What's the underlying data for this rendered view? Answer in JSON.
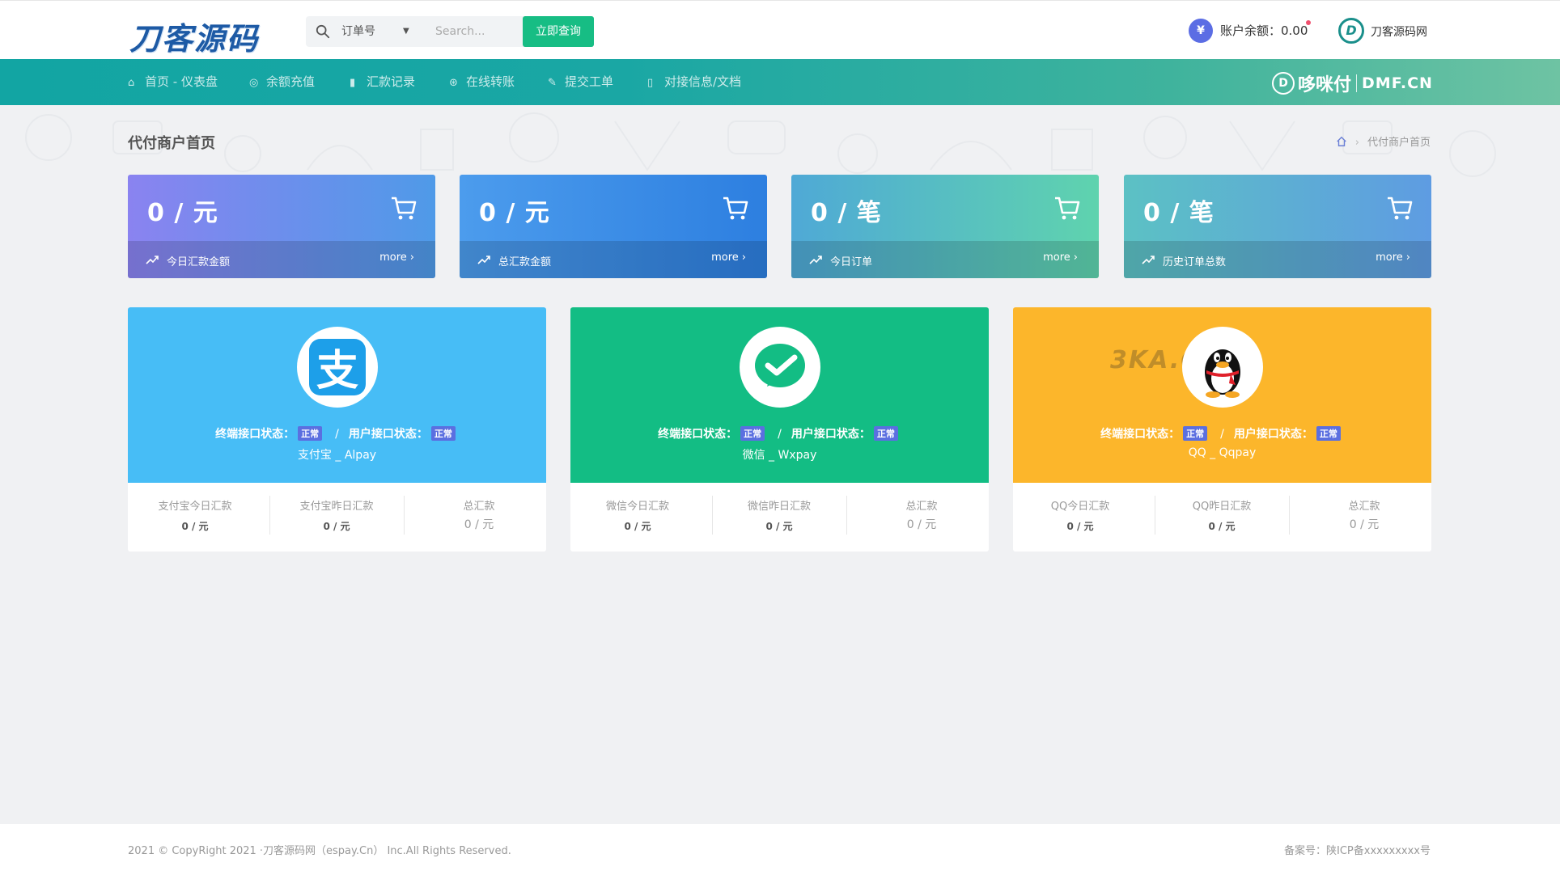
{
  "header": {
    "logo_text": "刀客源码",
    "search": {
      "select_value": "订单号",
      "placeholder": "Search...",
      "button": "立即查询"
    },
    "balance": {
      "icon": "¥",
      "label": "账户余额：0.00"
    },
    "user": {
      "name": "刀客源码网"
    }
  },
  "nav": {
    "items": [
      {
        "icon": "home-icon",
        "label": "首页 - 仪表盘"
      },
      {
        "icon": "recharge-icon",
        "label": "余额充值"
      },
      {
        "icon": "bar-chart-icon",
        "label": "汇款记录"
      },
      {
        "icon": "transfer-icon",
        "label": "在线转账"
      },
      {
        "icon": "edit-icon",
        "label": "提交工单"
      },
      {
        "icon": "doc-icon",
        "label": "对接信息/文档"
      }
    ],
    "brand": {
      "name": "哆咪付",
      "domain": "DMF.CN"
    }
  },
  "page": {
    "title": "代付商户首页",
    "breadcrumb": "代付商户首页"
  },
  "stats": [
    {
      "value": "0 / 元",
      "label": "今日汇款金额",
      "more": "more",
      "color_from": "#8a83f0",
      "color_to": "#4f9ae8"
    },
    {
      "value": "0 / 元",
      "label": "总汇款金额",
      "more": "more",
      "color_from": "#4c9ced",
      "color_to": "#2d7fe0"
    },
    {
      "value": "0 / 笔",
      "label": "今日订单",
      "more": "more",
      "color_from": "#4fa9d6",
      "color_to": "#5fd3ae"
    },
    {
      "value": "0 / 笔",
      "label": "历史订单总数",
      "more": "more",
      "color_from": "#5cc1c4",
      "color_to": "#5e9ce2"
    }
  ],
  "payments": [
    {
      "color": "#47bdf6",
      "terminal_label": "终端接口状态：",
      "terminal_status": "正常",
      "user_label": "用户接口状态：",
      "user_status": "正常",
      "slash": "/",
      "name": "支付宝 _ Alpay",
      "cols": [
        {
          "label": "支付宝今日汇款",
          "value": "0 / 元"
        },
        {
          "label": "支付宝昨日汇款",
          "value": "0 / 元"
        },
        {
          "label": "总汇款",
          "value": "0 / 元"
        }
      ]
    },
    {
      "color": "#13bd84",
      "terminal_label": "终端接口状态：",
      "terminal_status": "正常",
      "user_label": "用户接口状态：",
      "user_status": "正常",
      "slash": "/",
      "name": "微信 _ Wxpay",
      "cols": [
        {
          "label": "微信今日汇款",
          "value": "0 / 元"
        },
        {
          "label": "微信昨日汇款",
          "value": "0 / 元"
        },
        {
          "label": "总汇款",
          "value": "0 / 元"
        }
      ]
    },
    {
      "color": "#fcb62b",
      "terminal_label": "终端接口状态：",
      "terminal_status": "正常",
      "user_label": "用户接口状态：",
      "user_status": "正常",
      "slash": "/",
      "name": "QQ _ Qqpay",
      "watermark": "3KA.C",
      "cols": [
        {
          "label": "QQ今日汇款",
          "value": "0 / 元"
        },
        {
          "label": "QQ昨日汇款",
          "value": "0 / 元"
        },
        {
          "label": "总汇款",
          "value": "0 / 元"
        }
      ]
    }
  ],
  "footer": {
    "copyright": "2021 © CopyRight 2021 ·刀客源码网（espay.Cn） Inc.All Rights Reserved.",
    "icp": "备案号：陕ICP备xxxxxxxxx号"
  }
}
